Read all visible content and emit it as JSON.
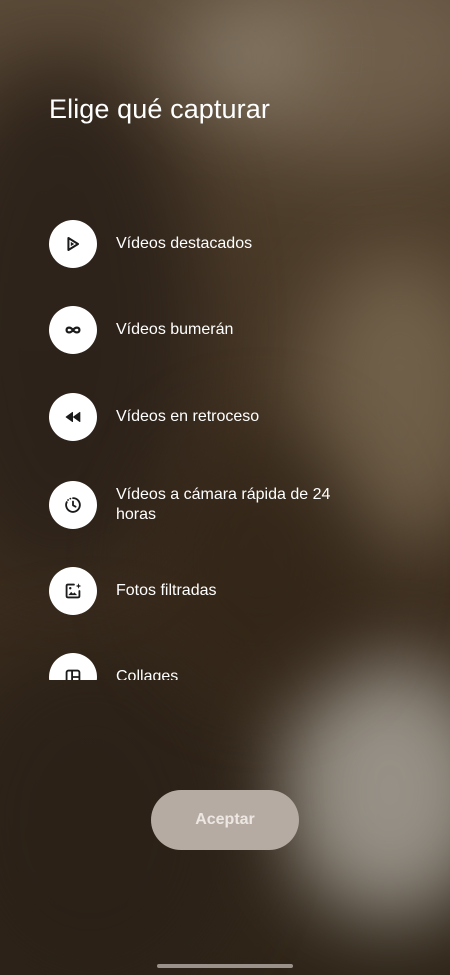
{
  "dialog": {
    "title": "Elige qué capturar"
  },
  "options": [
    {
      "label": "Vídeos destacados",
      "icon": "play-icon"
    },
    {
      "label": "Vídeos bumerán",
      "icon": "infinity-icon"
    },
    {
      "label": "Vídeos en retroceso",
      "icon": "rewind-icon"
    },
    {
      "label": "Vídeos a cámara rápida de 24 horas",
      "icon": "timer-icon"
    },
    {
      "label": "Fotos filtradas",
      "icon": "photo-sparkle-icon"
    },
    {
      "label": "Collages",
      "icon": "collage-icon"
    }
  ],
  "actions": {
    "accept_label": "Aceptar"
  },
  "colors": {
    "icon_circle": "#ffffff",
    "icon_glyph": "#1b1b1b",
    "accept_bg": "#b5aba2",
    "accept_text": "#ece7e2"
  }
}
